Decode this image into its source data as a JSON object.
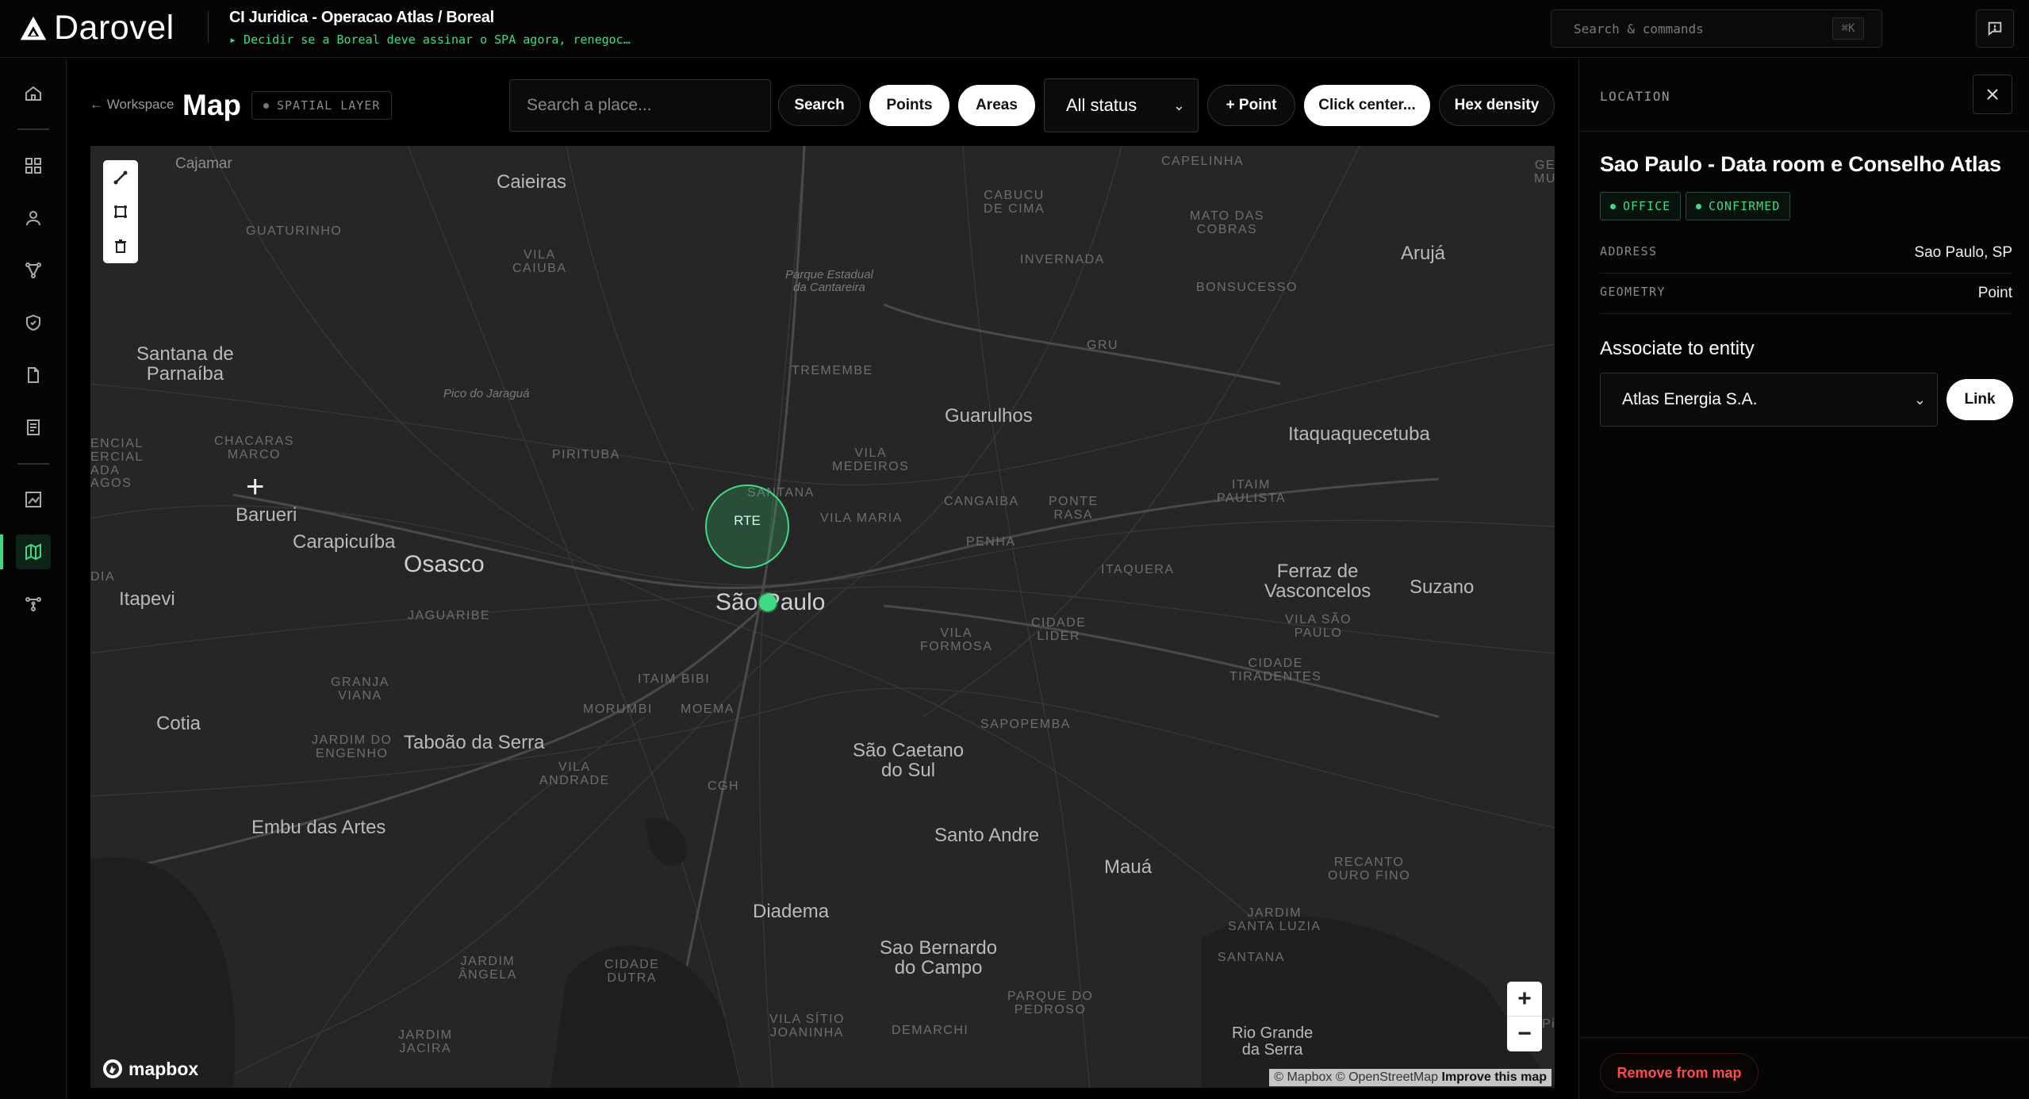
{
  "app": {
    "name": "Darovel",
    "case_title": "CI Juridica - Operacao Atlas / Boreal",
    "case_subtitle": "▸ Decidir se a Boreal deve assinar o SPA agora, renegoc…",
    "search_placeholder": "Search & commands",
    "search_shortcut": "⌘K"
  },
  "header": {
    "back_label": "← Workspace",
    "title": "Map",
    "layer_badge": "SPATIAL LAYER",
    "place_placeholder": "Search a place...",
    "search_button": "Search",
    "points_button": "Points",
    "areas_button": "Areas",
    "status_select": "All status",
    "add_point_button": "+ Point",
    "click_center_button": "Click center...",
    "hex_density_button": "Hex density"
  },
  "map": {
    "labels": [
      {
        "text": "Cajamar",
        "kind": "city"
      },
      {
        "text": "Caieiras",
        "kind": "city"
      },
      {
        "text": "GUATURINHO",
        "kind": "hood"
      },
      {
        "text": "VILA\nCAIUBA",
        "kind": "hood"
      },
      {
        "text": "Parque Estadual\nda Cantareira",
        "kind": "park"
      },
      {
        "text": "CABUCU\nDE CIMA",
        "kind": "hood"
      },
      {
        "text": "INVERNADA",
        "kind": "hood"
      },
      {
        "text": "CAPELINHA",
        "kind": "hood"
      },
      {
        "text": "MATO DAS\nCOBRAS",
        "kind": "hood"
      },
      {
        "text": "BONSUCESSO",
        "kind": "hood"
      },
      {
        "text": "Arujá",
        "kind": "city"
      },
      {
        "text": "GE\nMU",
        "kind": "hood"
      },
      {
        "text": "Santana de\nParnaíba",
        "kind": "city"
      },
      {
        "text": "Pico do Jaraguá",
        "kind": "park"
      },
      {
        "text": "TREMEMBE",
        "kind": "hood"
      },
      {
        "text": "GRU",
        "kind": "hood"
      },
      {
        "text": "Guarulhos",
        "kind": "city"
      },
      {
        "text": "Itaquaquecetuba",
        "kind": "city"
      },
      {
        "text": "ENCIAL\nERCIAL\nADA\nAGOS",
        "kind": "hood"
      },
      {
        "text": "CHACARAS\nMARCO",
        "kind": "hood"
      },
      {
        "text": "PIRITUBA",
        "kind": "hood"
      },
      {
        "text": "VILA\nMEDEIROS",
        "kind": "hood"
      },
      {
        "text": "SANTANA",
        "kind": "hood"
      },
      {
        "text": "CANGAIBA",
        "kind": "hood"
      },
      {
        "text": "PONTE\nRASA",
        "kind": "hood"
      },
      {
        "text": "ITAIM\nPAULISTA",
        "kind": "hood"
      },
      {
        "text": "Barueri",
        "kind": "city"
      },
      {
        "text": "VILA MARIA",
        "kind": "hood"
      },
      {
        "text": "Carapicuíba",
        "kind": "city"
      },
      {
        "text": "Osasco",
        "kind": "city-big"
      },
      {
        "text": "PENHA",
        "kind": "hood"
      },
      {
        "text": "ITAQUERA",
        "kind": "hood"
      },
      {
        "text": "Ferraz de\nVasconcelos",
        "kind": "city"
      },
      {
        "text": "Suzano",
        "kind": "city"
      },
      {
        "text": "DIA",
        "kind": "hood"
      },
      {
        "text": "Itapevi",
        "kind": "city"
      },
      {
        "text": "São Paulo",
        "kind": "city-big"
      },
      {
        "text": "JAGUARIBE",
        "kind": "hood"
      },
      {
        "text": "VILA SÃO\nPAULO",
        "kind": "hood"
      },
      {
        "text": "CIDADE\nLIDER",
        "kind": "hood"
      },
      {
        "text": "VILA\nFORMOSA",
        "kind": "hood"
      },
      {
        "text": "CIDADE\nTIRADENTES",
        "kind": "hood"
      },
      {
        "text": "GRANJA\nVIANA",
        "kind": "hood"
      },
      {
        "text": "ITAIM BIBI",
        "kind": "hood"
      },
      {
        "text": "MORUMBI",
        "kind": "hood"
      },
      {
        "text": "MOEMA",
        "kind": "hood"
      },
      {
        "text": "SAPOPEMBA",
        "kind": "hood"
      },
      {
        "text": "Cotia",
        "kind": "city"
      },
      {
        "text": "JARDIM DO\nENGENHO",
        "kind": "hood"
      },
      {
        "text": "Taboão da Serra",
        "kind": "city"
      },
      {
        "text": "São Caetano\ndo Sul",
        "kind": "city"
      },
      {
        "text": "VILA\nANDRADE",
        "kind": "hood"
      },
      {
        "text": "CGH",
        "kind": "hood"
      },
      {
        "text": "Embu das Artes",
        "kind": "city"
      },
      {
        "text": "Santo Andre",
        "kind": "city"
      },
      {
        "text": "Mauá",
        "kind": "city"
      },
      {
        "text": "RECANTO\nOURO FINO",
        "kind": "hood"
      },
      {
        "text": "Diadema",
        "kind": "city"
      },
      {
        "text": "JARDIM\nSANTA LUZIA",
        "kind": "hood"
      },
      {
        "text": "Sao Bernardo\ndo Campo",
        "kind": "city"
      },
      {
        "text": "SANTANA",
        "kind": "hood"
      },
      {
        "text": "JARDIM\nÂNGELA",
        "kind": "hood"
      },
      {
        "text": "CIDADE\nDUTRA",
        "kind": "hood"
      },
      {
        "text": "PARQUE DO\nPEDROSO",
        "kind": "hood"
      },
      {
        "text": "VILA SÍTIO\nJOANINHA",
        "kind": "hood"
      },
      {
        "text": "DEMARCHI",
        "kind": "hood"
      },
      {
        "text": "JARDIM\nJACIRA",
        "kind": "hood"
      },
      {
        "text": "Rio Grande\nda Serra",
        "kind": "city"
      },
      {
        "text": "Pi",
        "kind": "hood"
      }
    ],
    "area_label": "RTE",
    "logo": "mapbox",
    "attribution_prefix": "© Mapbox © OpenStreetMap",
    "attribution_link": "Improve this map",
    "zoom_in": "+",
    "zoom_out": "−"
  },
  "panel": {
    "kicker": "LOCATION",
    "title": "Sao Paulo - Data room e Conselho Atlas",
    "tags": [
      "OFFICE",
      "CONFIRMED"
    ],
    "fields": [
      {
        "key": "ADDRESS",
        "value": "Sao Paulo, SP"
      },
      {
        "key": "GEOMETRY",
        "value": "Point"
      }
    ],
    "associate_title": "Associate to entity",
    "entity_value": "Atlas Energia S.A.",
    "link_button": "Link",
    "remove_button": "Remove from map"
  },
  "colors": {
    "accent": "#3ddc84",
    "danger": "#ff4b4b",
    "map_bg": "#262626",
    "app_bg": "#000000"
  }
}
